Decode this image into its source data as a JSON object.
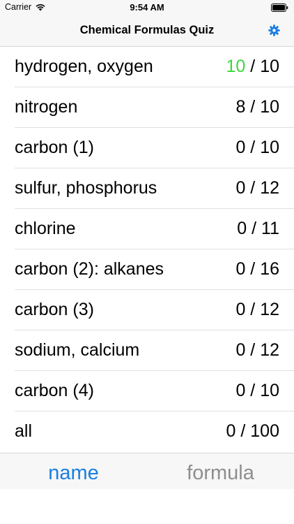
{
  "status_bar": {
    "carrier": "Carrier",
    "time": "9:54 AM"
  },
  "nav": {
    "title": "Chemical Formulas Quiz",
    "settings_icon": "gear-icon"
  },
  "quizzes": [
    {
      "label": "hydrogen, oxygen",
      "correct": "10",
      "total": "10"
    },
    {
      "label": "nitrogen",
      "correct": "8",
      "total": "10"
    },
    {
      "label": "carbon (1)",
      "correct": "0",
      "total": "10"
    },
    {
      "label": "sulfur, phosphorus",
      "correct": "0",
      "total": "12"
    },
    {
      "label": "chlorine",
      "correct": "0",
      "total": "11"
    },
    {
      "label": "carbon (2): alkanes",
      "correct": "0",
      "total": "16"
    },
    {
      "label": "carbon (3)",
      "correct": "0",
      "total": "12"
    },
    {
      "label": "sodium, calcium",
      "correct": "0",
      "total": "12"
    },
    {
      "label": "carbon (4)",
      "correct": "0",
      "total": "10"
    },
    {
      "label": "all",
      "correct": "0",
      "total": "100"
    }
  ],
  "score_separator": " / ",
  "tabs": [
    {
      "label": "name",
      "selected": true
    },
    {
      "label": "formula",
      "selected": false
    }
  ],
  "colors": {
    "accent": "#1a7ee0",
    "complete_score": "#3ad93a",
    "inactive_tab": "#8e8e8e"
  }
}
